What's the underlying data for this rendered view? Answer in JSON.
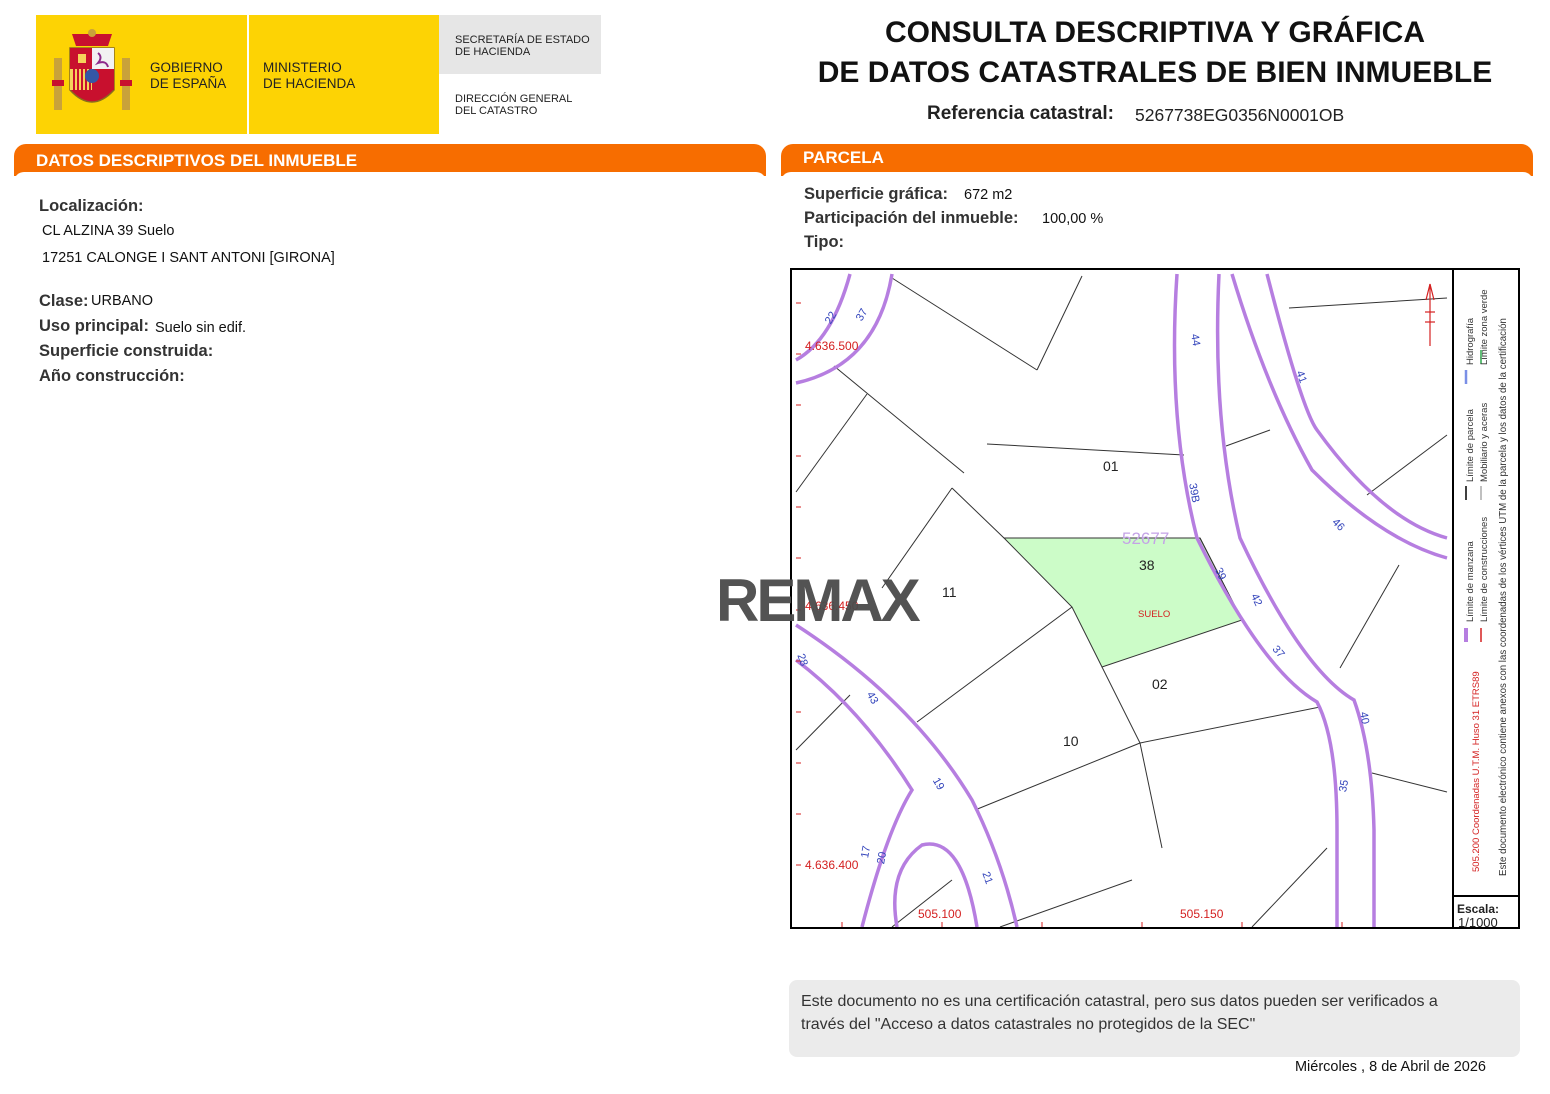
{
  "header": {
    "gobierno": "GOBIERNO\nDE ESPAÑA",
    "ministerio": "MINISTERIO\nDE HACIENDA",
    "secretaria": "SECRETARÍA DE ESTADO\nDE HACIENDA",
    "direccion": "DIRECCIÓN GENERAL\nDEL CATASTRO",
    "title_line1": "CONSULTA DESCRIPTIVA Y GRÁFICA",
    "title_line2": "DE DATOS CATASTRALES DE BIEN INMUEBLE",
    "ref_label": "Referencia catastral:",
    "ref_value": "5267738EG0356N0001OB"
  },
  "inmueble": {
    "section_title": "DATOS DESCRIPTIVOS DEL INMUEBLE",
    "localizacion_label": "Localización:",
    "address_line1": "CL ALZINA 39 Suelo",
    "address_line2": "17251 CALONGE I SANT ANTONI [GIRONA]",
    "clase_label": "Clase:",
    "clase_value": "URBANO",
    "uso_label": "Uso principal:",
    "uso_value": "Suelo sin edif.",
    "superficie_label": "Superficie construida:",
    "anio_label": "Año construcción:"
  },
  "parcela": {
    "section_title": "PARCELA",
    "superficie_label": "Superficie gráfica:",
    "superficie_value": "672 m2",
    "participacion_label": "Participación del inmueble:",
    "participacion_value": "100,00 %",
    "tipo_label": "Tipo:"
  },
  "map": {
    "coord_y1": "4.636.500",
    "coord_y2": "4.636.450",
    "coord_y3": "4.636.400",
    "coord_x1": "505.100",
    "coord_x2": "505.150",
    "block_id": "52677",
    "parcel_labels": [
      "01",
      "38",
      "11",
      "02",
      "10"
    ],
    "suelo": "SUELO",
    "street_numbers": [
      "22",
      "37",
      "44",
      "41",
      "39B",
      "46",
      "39",
      "42",
      "37",
      "40",
      "35",
      "43",
      "19",
      "17",
      "20",
      "21",
      "28"
    ],
    "legend_line1": "Límite de manzana",
    "legend_line2": "Límite de parcela",
    "legend_line3": "Hidrografía",
    "legend_line4": "Límite de construcciones",
    "legend_line5": "Mobiliario y aceras",
    "legend_line6": "Límite zona verde",
    "legend_utm": "505.200 Coordenadas U.T.M. Huso 31 ETRS89",
    "legend_doc": "Este documento electrónico contiene anexos con las coordenadas de los vértices UTM de la parcela y los datos de la certificación",
    "escala_label": "Escala:",
    "escala_value": "1/1000"
  },
  "watermark": "REMAX",
  "note": "Este documento no es una certificación catastral, pero sus datos pueden ser verificados a\ntravés del \"Acceso a datos catastrales no protegidos de la SEC\"",
  "date": "Miércoles , 8 de Abril de 2026",
  "colors": {
    "gov_yellow": "#fdd304",
    "section_orange": "#f76d00",
    "street_purple": "#b67ee0",
    "parcel_green": "#ccfcc8",
    "coord_red": "#d42020"
  }
}
